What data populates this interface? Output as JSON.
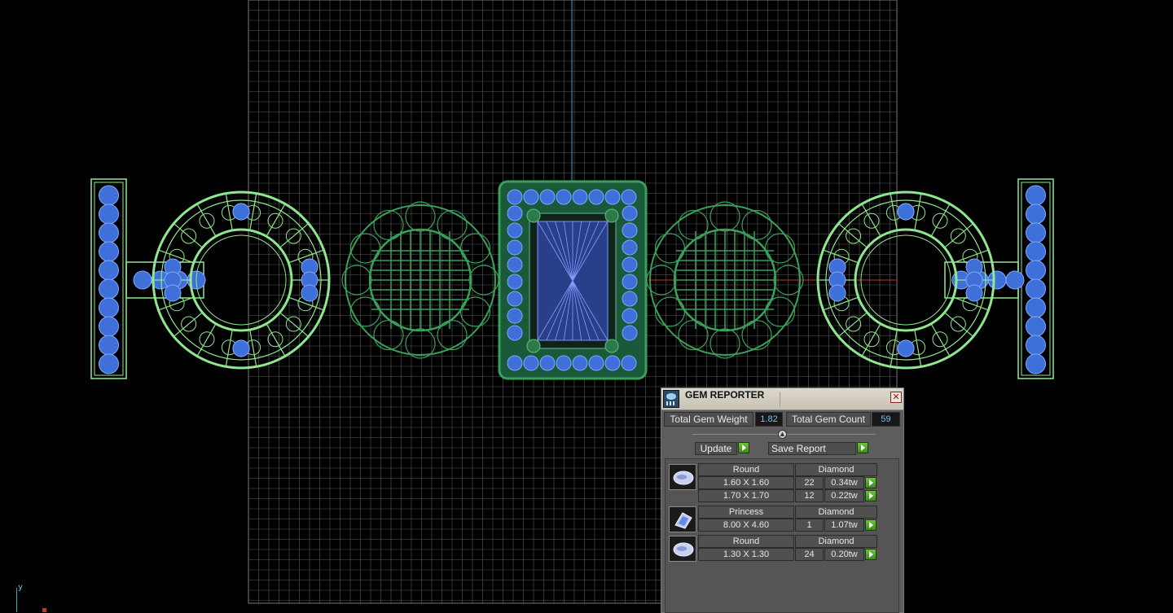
{
  "window": {
    "title": "GEM REPORTER"
  },
  "summary": {
    "weight_label": "Total Gem Weight",
    "weight_value": "1.82",
    "count_label": "Total Gem Count",
    "count_value": "59"
  },
  "actions": {
    "update": "Update",
    "save": "Save Report"
  },
  "groups": [
    {
      "icon": "round-gem-icon",
      "shape": "Round",
      "material": "Diamond",
      "rows": [
        {
          "size": "1.60 X 1.60",
          "count": "22",
          "weight": "0.34tw"
        },
        {
          "size": "1.70 X 1.70",
          "count": "12",
          "weight": "0.22tw"
        }
      ]
    },
    {
      "icon": "princess-gem-icon",
      "shape": "Princess",
      "material": "Diamond",
      "rows": [
        {
          "size": "8.00 X 4.60",
          "count": "1",
          "weight": "1.07tw"
        }
      ]
    },
    {
      "icon": "round-gem-icon",
      "shape": "Round",
      "material": "Diamond",
      "rows": [
        {
          "size": "1.30 X 1.30",
          "count": "24",
          "weight": "0.20tw"
        }
      ]
    }
  ],
  "axis": {
    "y": "y"
  },
  "colors": {
    "grid": "#5a5a5a",
    "wire_light": "#8fe88f",
    "wire_dark": "#3aa05a",
    "gem": "#3f6fd8",
    "axis_y": "#3aa6b8",
    "axis_x": "#c83030",
    "value_text": "#66c8f0"
  }
}
